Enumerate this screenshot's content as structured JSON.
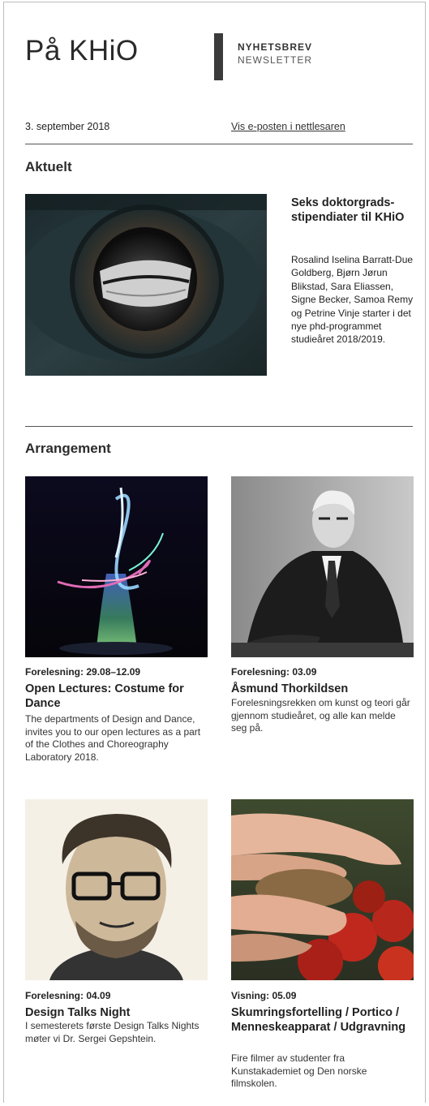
{
  "header": {
    "site_title": "På KHiO",
    "newsletter_no": "NYHETSBREV",
    "newsletter_en": "NEWSLETTER"
  },
  "meta": {
    "date": "3. september 2018",
    "view_in_browser": "Vis e-posten i nettlesaren"
  },
  "aktuelt": {
    "heading": "Aktuelt",
    "feature": {
      "title": "Seks doktorgrads-stipendiater til KHiO",
      "text": "Rosalind Iselina Barratt-Due Goldberg, Bjørn Jørun Blikstad, Sara Eliassen, Signe Becker, Samoa Remy og Petrine Vinje starter i det nye phd-programmet studieåret 2018/2019."
    }
  },
  "arrangement": {
    "heading": "Arrangement",
    "events": [
      {
        "meta": "Forelesning: 29.08–12.09",
        "title": "Open Lectures: Costume for Dance",
        "text": "The departments of Design and Dance, invites you to our open lectures as a part of the Clothes and Choreography Laboratory 2018."
      },
      {
        "meta": "Forelesning: 03.09",
        "title": "Åsmund Thorkildsen",
        "text": "Forelesningsrekken om kunst og teori går gjennom studieåret, og alle kan melde seg på."
      },
      {
        "meta": "Forelesning: 04.09",
        "title": "Design Talks Night",
        "text": "I semesterets første Design Talks Nights møter vi Dr. Sergei Gepshtein."
      },
      {
        "meta": "Visning: 05.09",
        "title": "Skumringsfortelling / Portico / Menneskeapparat / Udgravning",
        "text": "Fire filmer av studenter fra Kunstakademiet og Den norske filmskolen."
      }
    ]
  },
  "colors": {
    "text": "#1d1d1d",
    "rule": "#555555",
    "accent_bar": "#3b3b3b"
  }
}
